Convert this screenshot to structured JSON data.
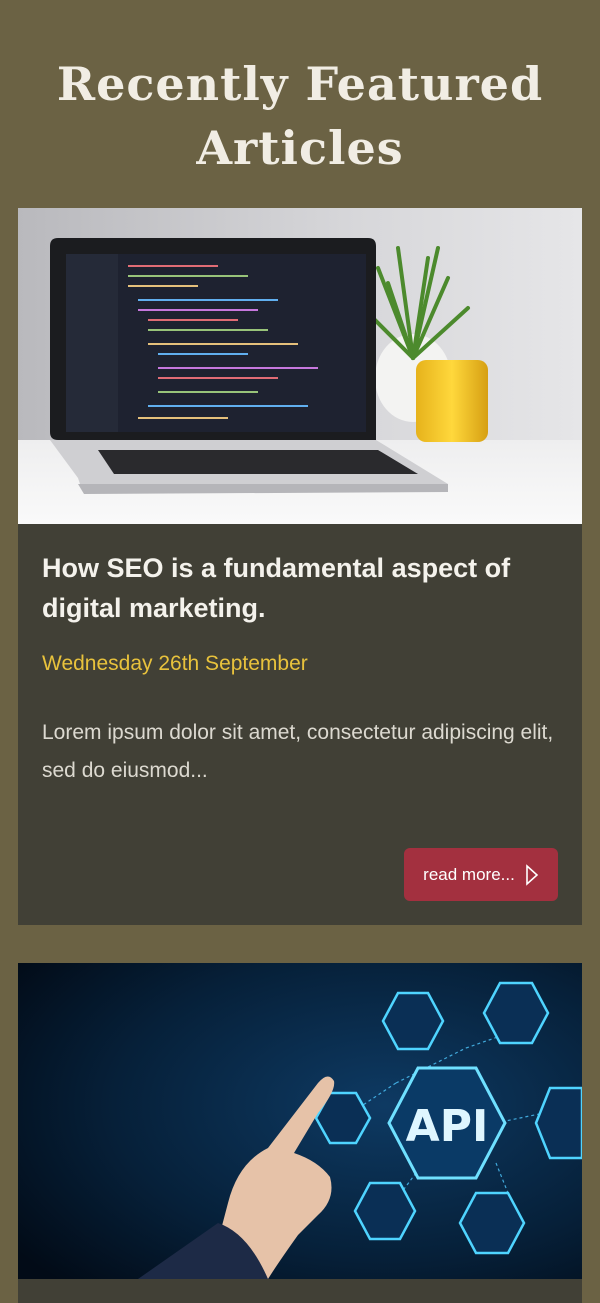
{
  "section": {
    "title_line1": "Recently Featured",
    "title_line2": "Articles"
  },
  "articles": [
    {
      "image_icon": "laptop-code-photo",
      "title": "How SEO is a fundamental aspect of digital marketing.",
      "date": "Wednesday 26th September",
      "excerpt": "Lorem ipsum dolor sit amet, consectetur adipiscing elit, sed do eiusmod...",
      "read_more_label": "read more..."
    },
    {
      "image_icon": "api-hexagon-photo",
      "image_text": "API"
    }
  ],
  "colors": {
    "page_bg": "#6b6244",
    "card_bg": "#414036",
    "date": "#e8c23c",
    "button": "#a3303f"
  }
}
